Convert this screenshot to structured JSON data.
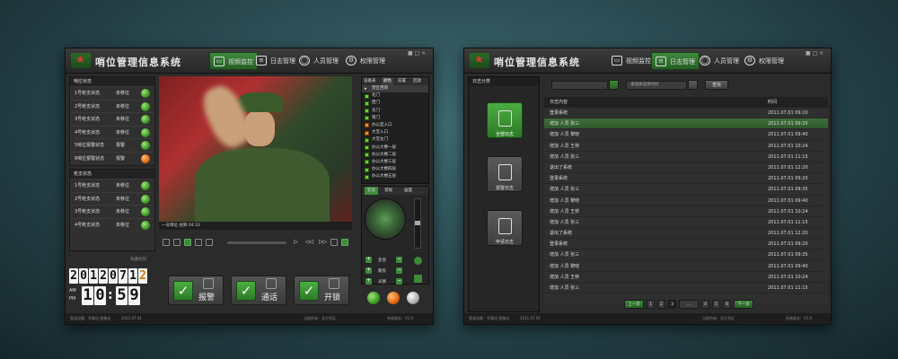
{
  "w1": {
    "title": "哨位管理信息系统",
    "tabs": [
      "视频监控",
      "日志管理",
      "人员管理",
      "权限管理"
    ],
    "ctl": "■ □ ×",
    "status": {
      "a": "登录设备：军事化 图像站",
      "b": "2011.07.01",
      "c": "当前所有：北方军区",
      "d": "系统版本：V1.0"
    },
    "sec1": {
      "title": "哨位状态",
      "rows": [
        {
          "a": "1号枪支状态",
          "b": "未移位",
          "c": "green"
        },
        {
          "a": "2号枪支状态",
          "b": "未移位",
          "c": "green"
        },
        {
          "a": "3号枪支状态",
          "b": "未移位",
          "c": "green"
        },
        {
          "a": "4号枪支状态",
          "b": "未移位",
          "c": "green"
        },
        {
          "a": "5哨位报警状态",
          "b": "报警",
          "c": "green"
        },
        {
          "a": "6哨位报警状态",
          "b": "报警",
          "c": "orange"
        }
      ]
    },
    "sec2": {
      "title": "枪支状态",
      "rows": [
        {
          "a": "1号枪支状态",
          "b": "未移位"
        },
        {
          "a": "2号枪支状态",
          "b": "未移位"
        },
        {
          "a": "3号枪支状态",
          "b": "未移位"
        },
        {
          "a": "4号枪支状态",
          "b": "未移位"
        }
      ]
    },
    "more": "隐藏找到",
    "clock": {
      "y": [
        "2",
        "0",
        "1",
        "2"
      ],
      "mo": [
        "0",
        "7"
      ],
      "d": [
        "1",
        "2"
      ],
      "am": "AM",
      "pm": "PM",
      "h": [
        "1",
        "0"
      ],
      "m": [
        "5",
        "9"
      ]
    },
    "video_caption": "一号哨位 视频 04:33",
    "devtabs": [
      "设备表",
      "颜色",
      "前置",
      "回放"
    ],
    "devices": [
      {
        "n": "营区西哨",
        "s": "sel"
      },
      {
        "n": "北门",
        "s": "g"
      },
      {
        "n": "西门",
        "s": "g"
      },
      {
        "n": "东门",
        "s": "g"
      },
      {
        "n": "南门",
        "s": "g"
      },
      {
        "n": "办公室入口",
        "s": "o"
      },
      {
        "n": "大堂入口",
        "s": "o"
      },
      {
        "n": "大堂左门",
        "s": "g"
      },
      {
        "n": "办公大楼一层",
        "s": "g"
      },
      {
        "n": "办公大楼二层",
        "s": "g"
      },
      {
        "n": "办公大楼三层",
        "s": "g"
      },
      {
        "n": "办公大楼四层",
        "s": "g"
      },
      {
        "n": "办公大楼五层",
        "s": "g"
      }
    ],
    "ptztabs": [
      "云台",
      "常规",
      "画面"
    ],
    "ptz": [
      "变倍",
      "聚焦",
      "光圈"
    ],
    "btns": [
      "报警",
      "通话",
      "开锁"
    ]
  },
  "w2": {
    "title": "哨位管理信息系统",
    "tabs": [
      "视频监控",
      "日志管理",
      "人员管理",
      "权限管理"
    ],
    "ctl": "■ □ ×",
    "status": {
      "a": "登录设备：军事化 图像站",
      "b": "2011.07.01",
      "c": "当前所有：北方军区",
      "d": "系统版本：V1.0"
    },
    "cat_title": "日志分类",
    "cats": [
      "全部日志",
      "报警日志",
      "申请日志"
    ],
    "search1": "",
    "search2": "请选择选择时间",
    "search_btn": "查找",
    "cols": [
      "日志内容",
      "时间"
    ],
    "rows": [
      [
        "登录系统",
        "2011.07.01 09:20"
      ],
      [
        "增加 人员 张三",
        "2011.07.01 09:35"
      ],
      [
        "增加 人员 黎晓",
        "2011.07.01 09:40"
      ],
      [
        "增加 人员 王林",
        "2011.07.01 10:24"
      ],
      [
        "增加 人员 张三",
        "2011.07.01 11:15"
      ],
      [
        "退出了系统",
        "2011.07.01 12:20"
      ],
      [
        "登录系统",
        "2011.07.01 09:20"
      ],
      [
        "增加 人员 张三",
        "2011.07.01 09:35"
      ],
      [
        "增加 人员 黎晓",
        "2011.07.01 09:40"
      ],
      [
        "增加 人员 王林",
        "2011.07.01 10:24"
      ],
      [
        "增加 人员 张三",
        "2011.07.01 11:15"
      ],
      [
        "退出了系统",
        "2011.07.01 12:20"
      ],
      [
        "登录系统",
        "2011.07.01 09:20"
      ],
      [
        "增加 人员 张三",
        "2011.07.01 09:35"
      ],
      [
        "增加 人员 黎晓",
        "2011.07.01 09:40"
      ],
      [
        "增加 人员 王林",
        "2011.07.01 10:24"
      ],
      [
        "增加 人员 张三",
        "2011.07.01 11:15"
      ]
    ],
    "pager": [
      "上一页",
      "1",
      "2",
      "3",
      "...",
      "4",
      "5",
      "6",
      "下一页"
    ]
  }
}
